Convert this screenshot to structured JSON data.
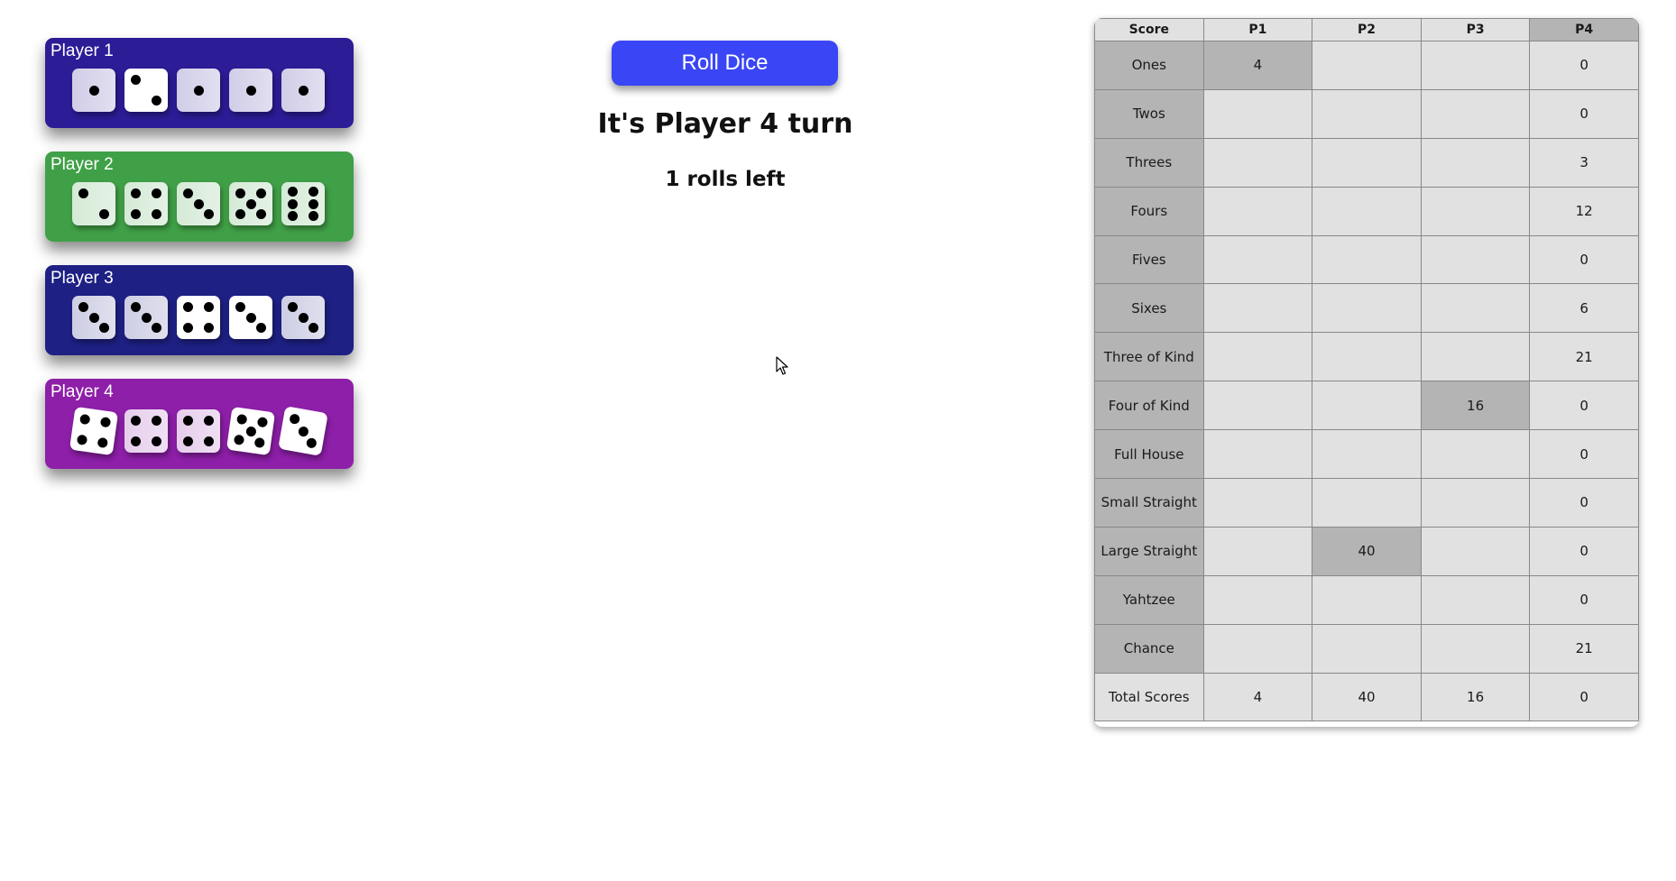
{
  "colors": {
    "roll_button": "#3a46f5",
    "die_face": "#ffffff",
    "pip": "#000000",
    "score_cell": "#e1e1e1",
    "score_used_cell": "#b4b4b4"
  },
  "players": [
    {
      "name": "Player 1",
      "color": "#2c1c96",
      "dice": [
        1,
        2,
        1,
        1,
        1
      ],
      "held": [
        true,
        false,
        true,
        true,
        true
      ],
      "tilt": [
        0,
        0,
        0,
        0,
        0
      ]
    },
    {
      "name": "Player 2",
      "color": "#40a047",
      "dice": [
        2,
        4,
        3,
        5,
        6
      ],
      "held": [
        true,
        true,
        true,
        true,
        true
      ],
      "tilt": [
        0,
        0,
        0,
        0,
        0
      ]
    },
    {
      "name": "Player 3",
      "color": "#1e2084",
      "dice": [
        3,
        3,
        4,
        3,
        3
      ],
      "held": [
        true,
        true,
        false,
        false,
        true
      ],
      "tilt": [
        0,
        0,
        0,
        0,
        0
      ]
    },
    {
      "name": "Player 4",
      "color": "#8d1fa8",
      "dice": [
        4,
        4,
        4,
        5,
        3
      ],
      "held": [
        false,
        true,
        true,
        false,
        false
      ],
      "tilt": [
        8,
        0,
        0,
        8,
        10
      ]
    }
  ],
  "controls": {
    "roll_label": "Roll Dice"
  },
  "status": {
    "turn_text": "It's Player 4 turn",
    "rolls_text": "1 rolls left"
  },
  "scorecard": {
    "header": [
      "Score",
      "P1",
      "P2",
      "P3",
      "P4"
    ],
    "active_column": 4,
    "rows": [
      {
        "label": "Ones",
        "values": [
          "4",
          "",
          "",
          "0"
        ],
        "used": [
          true,
          false,
          false,
          false
        ]
      },
      {
        "label": "Twos",
        "values": [
          "",
          "",
          "",
          "0"
        ],
        "used": [
          false,
          false,
          false,
          false
        ]
      },
      {
        "label": "Threes",
        "values": [
          "",
          "",
          "",
          "3"
        ],
        "used": [
          false,
          false,
          false,
          false
        ]
      },
      {
        "label": "Fours",
        "values": [
          "",
          "",
          "",
          "12"
        ],
        "used": [
          false,
          false,
          false,
          false
        ]
      },
      {
        "label": "Fives",
        "values": [
          "",
          "",
          "",
          "0"
        ],
        "used": [
          false,
          false,
          false,
          false
        ]
      },
      {
        "label": "Sixes",
        "values": [
          "",
          "",
          "",
          "6"
        ],
        "used": [
          false,
          false,
          false,
          false
        ]
      },
      {
        "label": "Three of Kind",
        "values": [
          "",
          "",
          "",
          "21"
        ],
        "used": [
          false,
          false,
          false,
          false
        ]
      },
      {
        "label": "Four of Kind",
        "values": [
          "",
          "",
          "16",
          "0"
        ],
        "used": [
          false,
          false,
          true,
          false
        ]
      },
      {
        "label": "Full House",
        "values": [
          "",
          "",
          "",
          "0"
        ],
        "used": [
          false,
          false,
          false,
          false
        ]
      },
      {
        "label": "Small Straight",
        "values": [
          "",
          "",
          "",
          "0"
        ],
        "used": [
          false,
          false,
          false,
          false
        ]
      },
      {
        "label": "Large Straight",
        "values": [
          "",
          "40",
          "",
          "0"
        ],
        "used": [
          false,
          true,
          false,
          false
        ]
      },
      {
        "label": "Yahtzee",
        "values": [
          "",
          "",
          "",
          "0"
        ],
        "used": [
          false,
          false,
          false,
          false
        ]
      },
      {
        "label": "Chance",
        "values": [
          "",
          "",
          "",
          "21"
        ],
        "used": [
          false,
          false,
          false,
          false
        ]
      }
    ],
    "total": {
      "label": "Total Scores",
      "values": [
        "4",
        "40",
        "16",
        "0"
      ]
    }
  }
}
